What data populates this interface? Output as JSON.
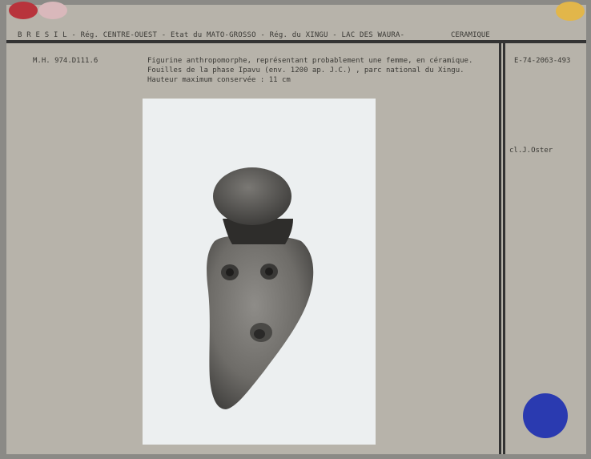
{
  "header": {
    "region_line": "B R E S I L  -  Rég. CENTRE-OUEST - Etat du MATO-GROSSO - Rég. du XINGU - LAC DES WAURA-",
    "category": "CERAMIQUE"
  },
  "record": {
    "inventory_number": "M.H. 974.D111.6",
    "description_lines": [
      "Figurine anthropomorphe, représentant probablement une femme, en céramique.",
      "Fouilles de la phase Ipavu (env. 1200 ap. J.C.) , parc national du Xingu.",
      "Hauteur maximum conservée : 11 cm"
    ],
    "reference": "E-74-2063-493",
    "photo_credit": "cl.J.Oster"
  },
  "colors": {
    "card": "#b7b3aa",
    "dot_red": "#b8343c",
    "dot_pink": "#d9b8bb",
    "dot_yellow": "#e2b64a",
    "dot_blue": "#2a3ab0"
  }
}
